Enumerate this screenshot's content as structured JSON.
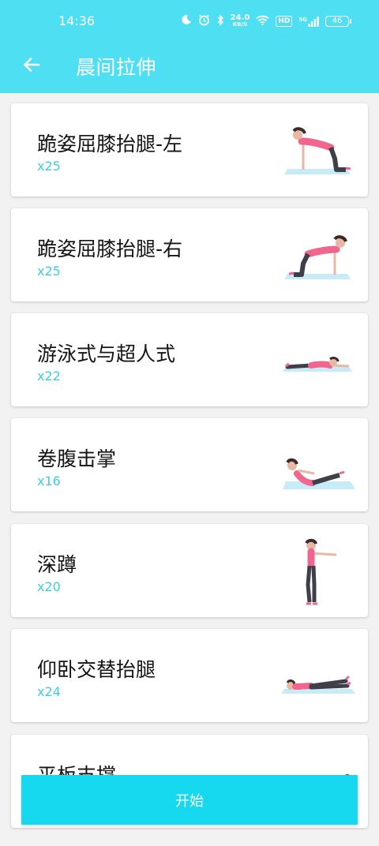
{
  "status_bar": {
    "time": "14:36",
    "network_speed": "24.0",
    "network_speed_unit": "KB/S",
    "hd_label": "HD",
    "signal_label": "5G",
    "battery": "46"
  },
  "header": {
    "title": "晨间拉伸",
    "back_icon": "arrow-left-icon"
  },
  "exercises": [
    {
      "name": "跪姿屈膝抬腿-左",
      "reps": "x25"
    },
    {
      "name": "跪姿屈膝抬腿-右",
      "reps": "x25"
    },
    {
      "name": "游泳式与超人式",
      "reps": "x22"
    },
    {
      "name": "卷腹击掌",
      "reps": "x16"
    },
    {
      "name": "深蹲",
      "reps": "x20"
    },
    {
      "name": "仰卧交替抬腿",
      "reps": "x24"
    },
    {
      "name": "平板支撑",
      "reps": ""
    }
  ],
  "start_button": {
    "label": "开始"
  },
  "colors": {
    "accent": "#4fdff3",
    "button": "#16d9f0",
    "reps_text": "#3ccfe0",
    "top_pink": "#f0668e",
    "pants": "#3f3f4a",
    "mat": "#c7ecf7"
  }
}
